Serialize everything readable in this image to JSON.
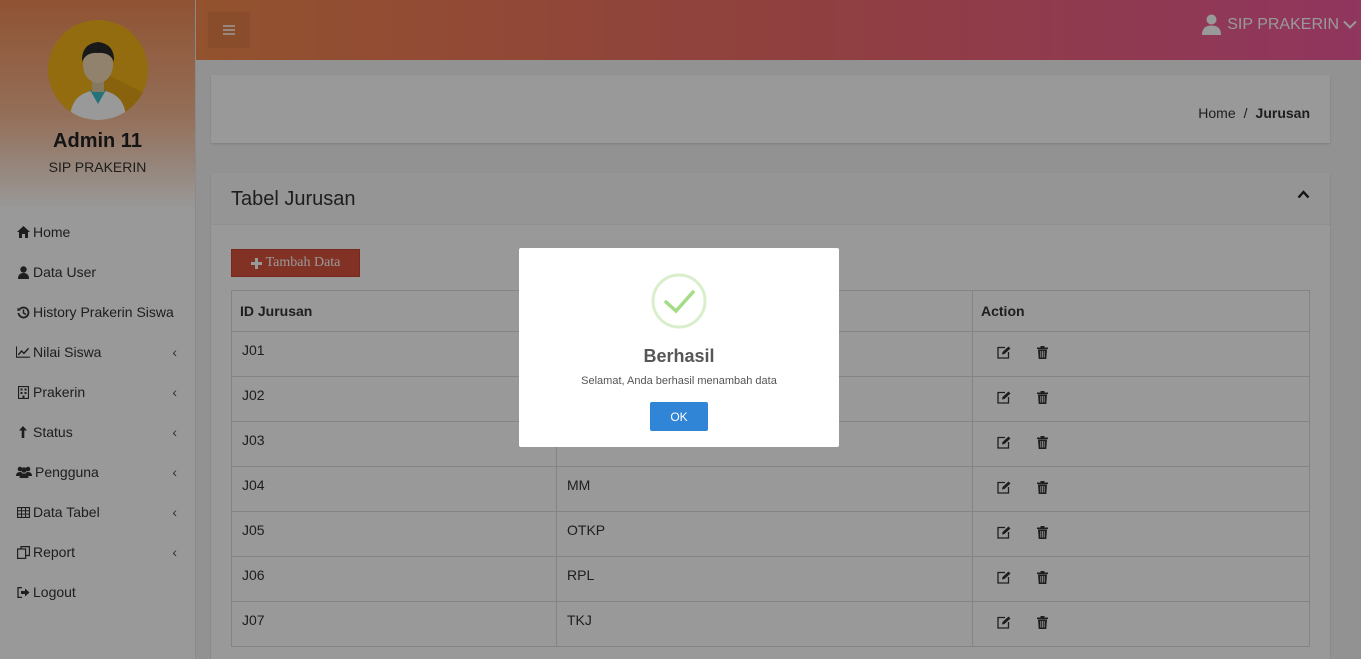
{
  "sidebar": {
    "profile": {
      "name": "Admin 11",
      "role": "SIP PRAKERIN"
    },
    "items": [
      {
        "label": "Home",
        "icon": "home-icon",
        "has_submenu": false
      },
      {
        "label": "Data User",
        "icon": "user-icon",
        "has_submenu": false
      },
      {
        "label": "History Prakerin Siswa",
        "icon": "history-icon",
        "has_submenu": false
      },
      {
        "label": "Nilai Siswa",
        "icon": "line-chart-icon",
        "has_submenu": true
      },
      {
        "label": "Prakerin",
        "icon": "building-icon",
        "has_submenu": true
      },
      {
        "label": "Status",
        "icon": "arrow-up-icon",
        "has_submenu": true
      },
      {
        "label": "Pengguna",
        "icon": "users-icon",
        "has_submenu": true
      },
      {
        "label": "Data Tabel",
        "icon": "table-icon",
        "has_submenu": true
      },
      {
        "label": "Report",
        "icon": "copy-icon",
        "has_submenu": true
      },
      {
        "label": "Logout",
        "icon": "sign-out-icon",
        "has_submenu": false
      }
    ],
    "chevron": "‹"
  },
  "topbar": {
    "user_label": "SIP PRAKERIN"
  },
  "breadcrumb": {
    "home": "Home",
    "separator": "/",
    "current": "Jurusan"
  },
  "box": {
    "title": "Tabel Jurusan",
    "add_button": "Tambah Data",
    "columns": [
      "ID Jurusan",
      "",
      "Action"
    ],
    "rows": [
      {
        "id": "J01",
        "name": ""
      },
      {
        "id": "J02",
        "name": ""
      },
      {
        "id": "J03",
        "name": ""
      },
      {
        "id": "J04",
        "name": "MM"
      },
      {
        "id": "J05",
        "name": "OTKP"
      },
      {
        "id": "J06",
        "name": "RPL"
      },
      {
        "id": "J07",
        "name": "TKJ"
      }
    ]
  },
  "modal": {
    "title": "Berhasil",
    "text": "Selamat, Anda berhasil menambah data",
    "ok": "OK"
  },
  "colors": {
    "topbar_start": "#f58a4d",
    "topbar_end": "#f05a9e",
    "add_button": "#d9533e",
    "ok_button": "#3085d6",
    "success": "#a5dc86"
  }
}
